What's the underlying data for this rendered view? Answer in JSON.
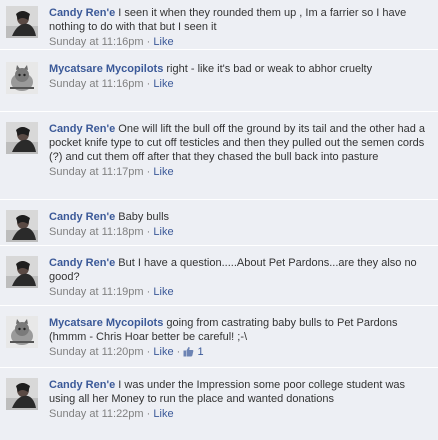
{
  "comments": [
    {
      "author": "Candy Ren'e",
      "avatar": "candy-avatar",
      "text": "I seen it when they rounded them up , Im a farrier so I have nothing to do with that but I seen it",
      "time": "Sunday at 11:16pm",
      "like_label": "Like"
    },
    {
      "author": "Mycatsare Mycopilots",
      "avatar": "cat-avatar",
      "text": "right - like it's bad or weak to abhor cruelty",
      "time": "Sunday at 11:16pm",
      "like_label": "Like"
    },
    {
      "author": "Candy Ren'e",
      "avatar": "candy-avatar",
      "text": "One will lift the bull off the ground by its tail and the other had a pocket knife type to cut off testicles and then they pulled out the semen cords (?) and cut them off after that they chased the bull back into pasture",
      "time": "Sunday at 11:17pm",
      "like_label": "Like"
    },
    {
      "author": "Candy Ren'e",
      "avatar": "candy-avatar",
      "text": "Baby bulls",
      "time": "Sunday at 11:18pm",
      "like_label": "Like"
    },
    {
      "author": "Candy Ren'e",
      "avatar": "candy-avatar",
      "text": "But I have a question.....About Pet Pardons...are they also no good?",
      "time": "Sunday at 11:19pm",
      "like_label": "Like"
    },
    {
      "author": "Mycatsare Mycopilots",
      "avatar": "cat-avatar",
      "text": "going from castrating baby bulls to Pet Pardons (hmmm - Chris Hoar better be careful! ;-\\",
      "time": "Sunday at 11:20pm",
      "like_label": "Like",
      "like_count": "1",
      "like_icon": "thumbs-up-icon"
    },
    {
      "author": "Candy Ren'e",
      "avatar": "candy-avatar",
      "text": "I was under the Impression some poor college student was using all her Money to run the place and wanted donations",
      "time": "Sunday at 11:22pm",
      "like_label": "Like"
    }
  ],
  "separator": "·",
  "colors": {
    "background": "#edeff4",
    "author_link": "#3b5998",
    "meta_text": "#808080",
    "body_text": "#333333"
  }
}
